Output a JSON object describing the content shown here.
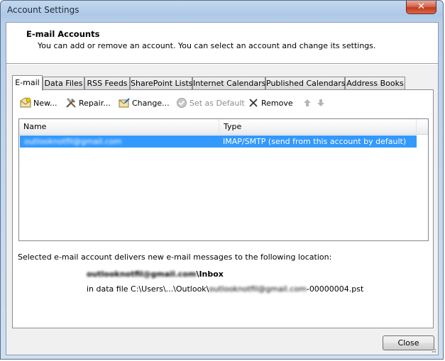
{
  "window": {
    "title": "Account Settings",
    "close_glyph": "✕"
  },
  "header": {
    "title": "E-mail Accounts",
    "subtitle": "You can add or remove an account. You can select an account and change its settings."
  },
  "tabs": [
    {
      "label": "E-mail",
      "active": true
    },
    {
      "label": "Data Files",
      "active": false
    },
    {
      "label": "RSS Feeds",
      "active": false
    },
    {
      "label": "SharePoint Lists",
      "active": false
    },
    {
      "label": "Internet Calendars",
      "active": false
    },
    {
      "label": "Published Calendars",
      "active": false
    },
    {
      "label": "Address Books",
      "active": false
    }
  ],
  "toolbar": {
    "new_label": "New...",
    "repair_label": "Repair...",
    "change_label": "Change...",
    "set_default_label": "Set as Default",
    "remove_label": "Remove",
    "move_up_icon": "arrow-up-icon",
    "move_down_icon": "arrow-down-icon"
  },
  "accounts_list": {
    "columns": [
      "Name",
      "Type"
    ],
    "rows": [
      {
        "name": "outlooknotfil@gmail.com",
        "type": "IMAP/SMTP (send from this account by default)",
        "selected": true
      }
    ]
  },
  "delivery": {
    "label": "Selected e-mail account delivers new e-mail messages to the following location:",
    "account": "outlooknotfil@gmail.com",
    "folder": "\\Inbox",
    "data_file_prefix": "in data file C:\\Users\\...\\Outlook\\",
    "data_file_account": "outlooknotfil@gmail.com",
    "data_file_suffix": "-00000004.pst"
  },
  "footer": {
    "close_label": "Close"
  },
  "colors": {
    "selection": "#3399ff",
    "title_close": "#c33b1d"
  }
}
